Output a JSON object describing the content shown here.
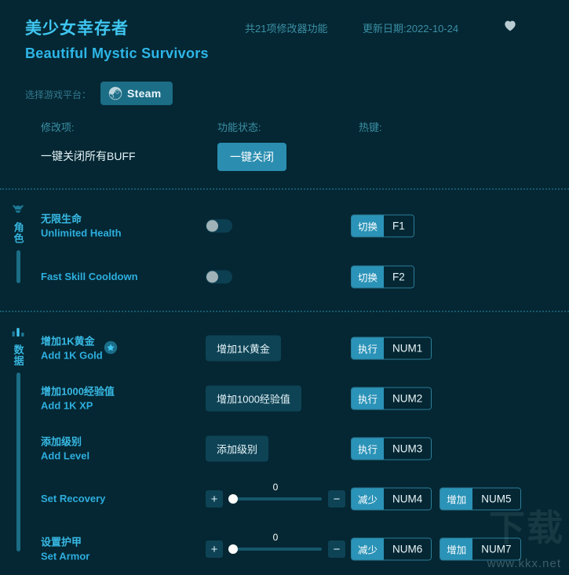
{
  "header": {
    "title_cn": "美少女幸存者",
    "title_en": "Beautiful Mystic Survivors",
    "feature_count": "共21项修改器功能",
    "update_date": "更新日期:2022-10-24",
    "favorite_icon": "heart-icon"
  },
  "platform": {
    "label": "选择游戏平台：",
    "selected": "Steam",
    "icon": "steam-icon"
  },
  "columns": {
    "name": "修改项:",
    "status": "功能状态:",
    "hotkey": "热键:"
  },
  "global": {
    "name": "一键关闭所有BUFF",
    "button": "一键关闭"
  },
  "sections": [
    {
      "id": "character",
      "rail_label": "角色",
      "rail_icon": "helmet-icon",
      "rows": [
        {
          "label_cn": "无限生命",
          "label_en": "Unlimited Health",
          "control": "toggle",
          "toggle_on": false,
          "starred": false,
          "hotkeys": [
            {
              "action": "切换",
              "key": "F1"
            }
          ]
        },
        {
          "label_cn": "",
          "label_en": "Fast Skill Cooldown",
          "control": "toggle",
          "toggle_on": false,
          "starred": false,
          "hotkeys": [
            {
              "action": "切换",
              "key": "F2"
            }
          ]
        }
      ]
    },
    {
      "id": "data",
      "rail_label": "数据",
      "rail_icon": "bar-chart-icon",
      "rows": [
        {
          "label_cn": "增加1K黄金",
          "label_en": "Add 1K Gold",
          "control": "button",
          "button_label": "增加1K黄金",
          "starred": true,
          "star_icon": "star-badge-icon",
          "hotkeys": [
            {
              "action": "执行",
              "key": "NUM1"
            }
          ]
        },
        {
          "label_cn": "增加1000经验值",
          "label_en": "Add 1K XP",
          "control": "button",
          "button_label": "增加1000经验值",
          "starred": false,
          "hotkeys": [
            {
              "action": "执行",
              "key": "NUM2"
            }
          ]
        },
        {
          "label_cn": "添加级别",
          "label_en": "Add Level",
          "control": "button",
          "button_label": "添加级别",
          "starred": false,
          "hotkeys": [
            {
              "action": "执行",
              "key": "NUM3"
            }
          ]
        },
        {
          "label_cn": "",
          "label_en": "Set Recovery",
          "control": "slider",
          "slider_value": "0",
          "slider_plus": "+",
          "slider_minus": "−",
          "starred": false,
          "hotkeys": [
            {
              "action": "减少",
              "key": "NUM4"
            },
            {
              "action": "增加",
              "key": "NUM5"
            }
          ]
        },
        {
          "label_cn": "设置护甲",
          "label_en": "Set Armor",
          "control": "slider",
          "slider_value": "0",
          "slider_plus": "+",
          "slider_minus": "−",
          "starred": false,
          "hotkeys": [
            {
              "action": "减少",
              "key": "NUM6"
            },
            {
              "action": "增加",
              "key": "NUM7"
            }
          ]
        }
      ]
    }
  ],
  "watermark": {
    "text_cn": "下载",
    "url": "www.kkx.net"
  },
  "colors": {
    "background": "#042733",
    "accent": "#2b93b8",
    "title": "#3fc6f0",
    "label": "#38b9e4",
    "muted": "#3b8fa5"
  }
}
